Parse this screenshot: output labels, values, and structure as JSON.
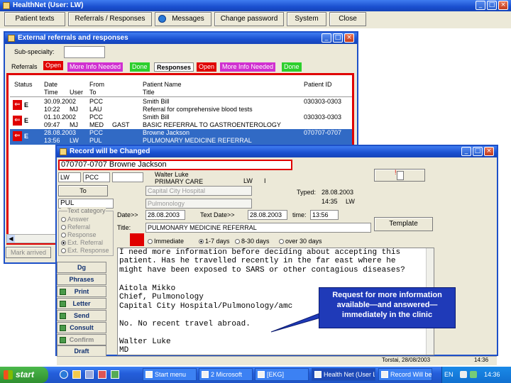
{
  "app": {
    "title": "HealthNet (User: LW)"
  },
  "menu": [
    "Patient texts",
    "Referrals / Responses",
    "Messages",
    "Change password",
    "System",
    "Close"
  ],
  "referrals_window": {
    "title": "External referrals and responses",
    "subspecialty_label": "Sub-specialty:",
    "subspecialty_value": "",
    "referral_tabs": [
      "Referrals",
      "Open",
      "More Info Needed",
      "Done"
    ],
    "response_tabs": [
      "Responses",
      "Open",
      "More Info Needed",
      "Done"
    ],
    "columns": {
      "status": "Status",
      "date": "Date",
      "time": "Time",
      "user": "User",
      "from": "From",
      "to": "To",
      "patient_name": "Patient Name",
      "title": "Title",
      "patient_id": "Patient ID"
    },
    "rows": [
      {
        "status": "E",
        "date": "30.09.2002",
        "time": "10:22",
        "user": "MJ",
        "from": "PCC",
        "to": "LAU",
        "to_extra": "",
        "name": "Smith Bill",
        "title": "Referral for comprehensive blood tests",
        "id": "030303-0303"
      },
      {
        "status": "E",
        "date": "01.10.2002",
        "time": "09:47",
        "user": "MJ",
        "from": "PCC",
        "to": "MED",
        "to_extra": "GAST",
        "name": "Smith Bill",
        "title": "BASIC REFERRAL TO GASTROENTEROLOGY",
        "id": "030303-0303"
      },
      {
        "status": "E",
        "date": "28.08.2003",
        "time": "13:56",
        "user": "LW",
        "from": "PCC",
        "to": "PUL",
        "to_extra": "",
        "name": "Browne Jackson",
        "title": "PULMONARY MEDICINE REFERRAL",
        "id": "070707-0707"
      }
    ],
    "mark_arrived": "Mark arrived"
  },
  "dialog": {
    "title": "Record will be Changed",
    "patient": "070707-0707   Browne Jackson",
    "user": "LW",
    "from": "PCC",
    "sender_name": "Walter Luke",
    "sender_dept": "PRIMARY CARE",
    "sender_code": "LW",
    "sender_suffix": "I",
    "to_button": "To",
    "to_hospital": "Capital City Hospital",
    "to_value": "PUL",
    "to_dept": "Pulmonology",
    "typed_label": "Typed:",
    "typed_date": "28.08.2003",
    "typed_time": "14:35",
    "typed_user": "LW",
    "text_category_label": "Text category",
    "categories": [
      "Answer",
      "Referral",
      "Response",
      "Ext. Referral",
      "Ext. Response"
    ],
    "date_label": "Date>>",
    "date_value": "28.08.2003",
    "text_date_label": "Text Date>>",
    "text_date_value": "28.08.2003",
    "time_label": "time:",
    "time_value": "13:56",
    "title_label": "Title:",
    "title_value": "PULMONARY MEDICINE REFERRAL",
    "template_button": "Template",
    "urgency": [
      "Immediate",
      "1-7 days",
      "8-30 days",
      "over 30 days"
    ],
    "buttons": [
      "Dg",
      "Phrases",
      "Print",
      "Letter",
      "Send",
      "Consult",
      "Confirm",
      "Draft"
    ],
    "memo_lines": [
      "I need more information before deciding about accepting this",
      "patient. Has he travelled recently in the far east where he",
      "might have been exposed to SARS or other contagious diseases?",
      "",
      "Aitola Mikko",
      "Chief, Pulmonology",
      "Capital City Hospital/Pulmonology/amc",
      "",
      "No. No recent travel abroad.",
      "",
      "Walter Luke",
      "MD"
    ],
    "status_bar": "Torstai, 28/08/2003",
    "status_time": "14:36"
  },
  "callout": {
    "text": "Request for more information available—and answered—immediately in the clinic"
  },
  "taskbar": {
    "start": "start",
    "tasks": [
      "Start menu",
      "2 Microsoft",
      "[EKG]",
      "Health Net (User LW)",
      "Record Will be Changed"
    ],
    "lang": "EN",
    "clock": "14:36"
  },
  "colors": {
    "accent_red": "#e00000",
    "tab_magenta": "#d030d0",
    "tab_green": "#2ccf2c",
    "selection_blue": "#316ac5"
  }
}
